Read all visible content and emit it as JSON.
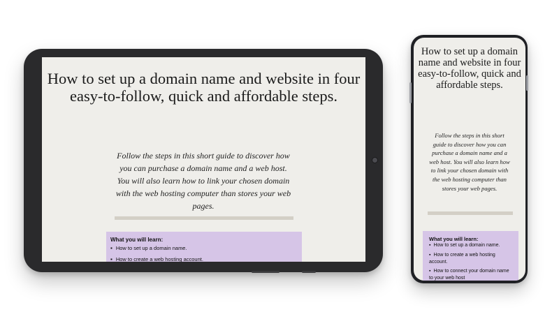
{
  "article": {
    "title": "How to set up a domain name and website in four easy-to-follow, quick and affordable steps.",
    "intro": "Follow the steps in this short guide to discover how you can purchase a domain name and a web host. You will also learn how to link your chosen domain with the web hosting computer than stores your web pages.",
    "learn_heading": "What you will learn:",
    "learn_items": [
      "How to set up a domain name.",
      "How to create a web hosting account.",
      "How to connect your domain name to your web host"
    ]
  },
  "colors": {
    "page_background": "#efeeea",
    "box_background": "#d6c5e7",
    "divider": "#d3cfc6",
    "device_frame": "#2a2a2c"
  }
}
